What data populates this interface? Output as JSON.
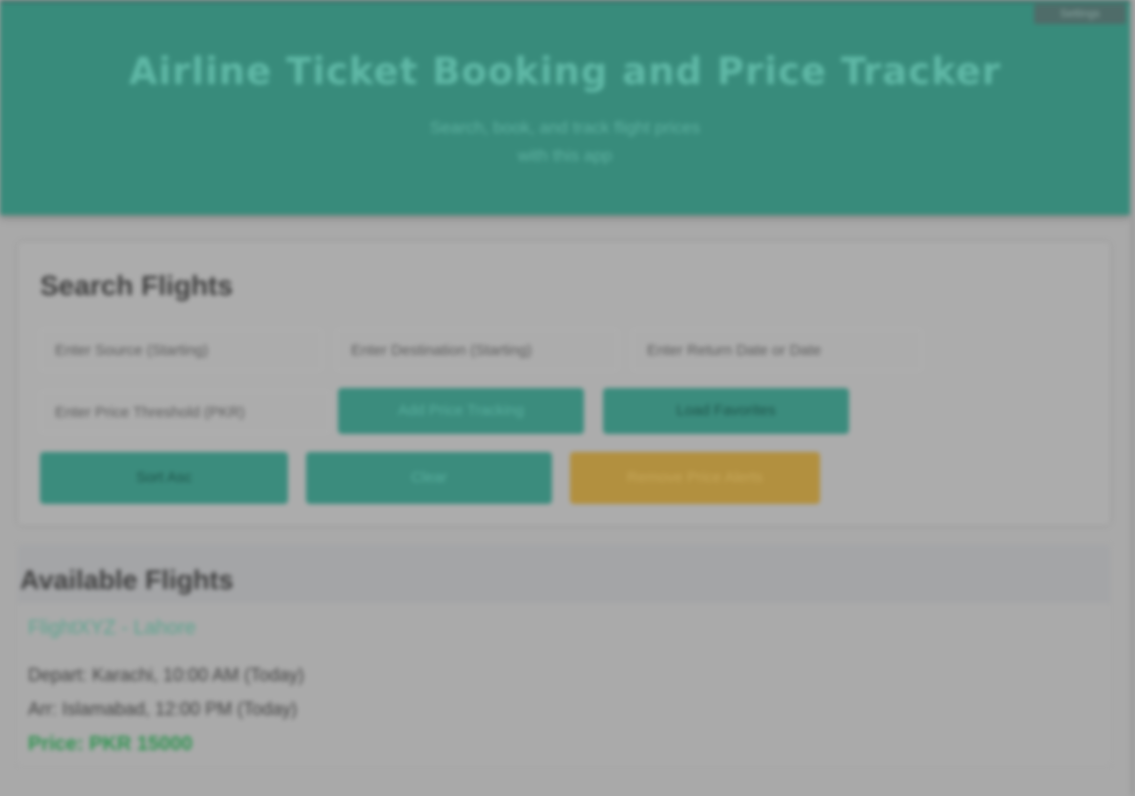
{
  "header": {
    "title": "Airline Ticket Booking and Price Tracker",
    "subtitle_line1": "Search, book, and track flight prices",
    "subtitle_line2": "with this app",
    "corner_button": "Settings"
  },
  "search": {
    "heading": "Search Flights",
    "source_placeholder": "Enter Source (Starting)",
    "destination_placeholder": "Enter Destination (Starting)",
    "date_placeholder": "Enter Return Date or Date",
    "price_placeholder": "Enter Price Threshold (PKR)",
    "buttons": {
      "search": "Add Price Tracking",
      "track": "Load Favorites",
      "sort": "Sort Asc",
      "filter": "Clear",
      "saved": "Remove Price Alerts"
    }
  },
  "results": {
    "heading": "Available Flights",
    "flights": [
      {
        "title": "FlightXYZ - Lahore",
        "departure": "Depart: Karachi, 10:00 AM (Today)",
        "arrival": "Arr: Islamabad, 12:00 PM (Today)",
        "price": "Price: PKR 15000"
      }
    ]
  },
  "colors": {
    "header_bg": "#388b7b",
    "accent": "#3b8c7d",
    "warning_button": "#b2903f",
    "price_text": "#2e9450"
  }
}
